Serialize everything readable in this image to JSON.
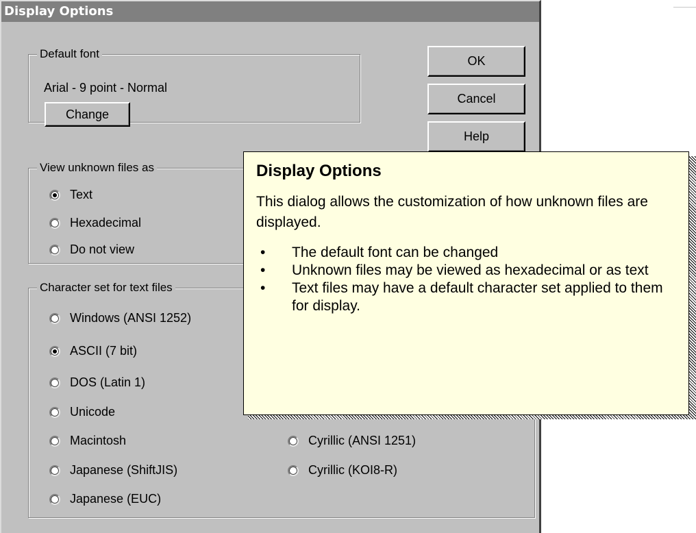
{
  "dialog": {
    "title": "Display Options",
    "buttons": {
      "ok": "OK",
      "cancel": "Cancel",
      "help": "Help"
    },
    "default_font": {
      "label": "Default font",
      "value": "Arial - 9 point - Normal",
      "change_button": "Change"
    },
    "view_unknown": {
      "label": "View unknown files as",
      "options": [
        {
          "label": "Text",
          "selected": true
        },
        {
          "label": "Hexadecimal",
          "selected": false
        },
        {
          "label": "Do not view",
          "selected": false
        }
      ]
    },
    "charset": {
      "label": "Character set for text files",
      "left_options": [
        {
          "label": "Windows (ANSI 1252)",
          "selected": false
        },
        {
          "label": "ASCII (7 bit)",
          "selected": true
        },
        {
          "label": "DOS (Latin 1)",
          "selected": false
        },
        {
          "label": "Unicode",
          "selected": false
        },
        {
          "label": "Macintosh",
          "selected": false
        },
        {
          "label": "Japanese (ShiftJIS)",
          "selected": false
        },
        {
          "label": "Japanese (EUC)",
          "selected": false
        }
      ],
      "right_options": [
        {
          "label": "Cyrillic (ANSI 1251)",
          "selected": false
        },
        {
          "label": "Cyrillic (KOI8-R)",
          "selected": false
        }
      ]
    }
  },
  "help_popup": {
    "title": "Display Options",
    "text": "This dialog allows the customization of how unknown files are displayed.",
    "bullets": [
      "The default font can be changed",
      "Unknown files may be viewed as hexadecimal or as text",
      "Text files may have a default character set applied to them for display."
    ]
  },
  "icons": {
    "bullet": "•"
  }
}
